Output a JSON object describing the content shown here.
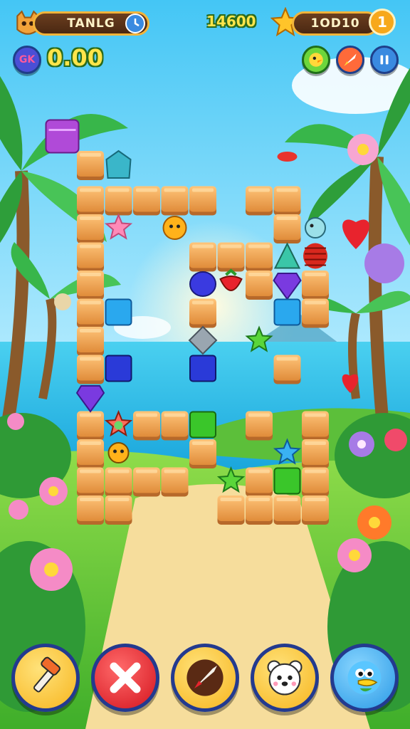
{
  "hud": {
    "left_label": "TANLG",
    "center_score": "14600",
    "right_label": "1OD10",
    "coins_value": "0.00",
    "coin_badge": "GK",
    "right_badge": "1"
  },
  "colors": {
    "tile": "#f0a44e",
    "tile_edge": "#b7692a",
    "sky": "#7fd6ff",
    "sea": "#2ab7e6",
    "grass": "#6bcf3f",
    "sand": "#f6dd9c"
  },
  "board": {
    "tiles": [
      [
        1,
        0
      ],
      [
        1,
        1
      ],
      [
        2,
        1
      ],
      [
        3,
        1
      ],
      [
        4,
        1
      ],
      [
        5,
        1
      ],
      [
        7,
        1
      ],
      [
        8,
        1
      ],
      [
        1,
        2
      ],
      [
        8,
        2
      ],
      [
        1,
        3
      ],
      [
        5,
        3
      ],
      [
        6,
        3
      ],
      [
        7,
        3
      ],
      [
        1,
        4
      ],
      [
        7,
        4
      ],
      [
        9,
        4
      ],
      [
        1,
        5
      ],
      [
        5,
        5
      ],
      [
        9,
        5
      ],
      [
        1,
        6
      ],
      [
        1,
        7
      ],
      [
        8,
        7
      ],
      [
        1,
        9
      ],
      [
        3,
        9
      ],
      [
        4,
        9
      ],
      [
        7,
        9
      ],
      [
        9,
        9
      ],
      [
        1,
        10
      ],
      [
        5,
        10
      ],
      [
        9,
        10
      ],
      [
        1,
        11
      ],
      [
        2,
        11
      ],
      [
        3,
        11
      ],
      [
        4,
        11
      ],
      [
        7,
        11
      ],
      [
        9,
        11
      ],
      [
        1,
        12
      ],
      [
        2,
        12
      ],
      [
        6,
        12
      ],
      [
        7,
        12
      ],
      [
        8,
        12
      ],
      [
        9,
        12
      ]
    ],
    "items": [
      {
        "name": "purple-gem",
        "col": 0,
        "row": -1
      },
      {
        "name": "teal-gem",
        "col": 2,
        "row": 0
      },
      {
        "name": "crab-icon",
        "col": 8,
        "row": 0
      },
      {
        "name": "pink-star",
        "col": 2,
        "row": 2
      },
      {
        "name": "sun-creature",
        "col": 4,
        "row": 2
      },
      {
        "name": "fish-creature",
        "col": 9,
        "row": 2
      },
      {
        "name": "cone-gem",
        "col": 8,
        "row": 3
      },
      {
        "name": "red-barrel",
        "col": 9,
        "row": 3
      },
      {
        "name": "blue-blob",
        "col": 5,
        "row": 4
      },
      {
        "name": "strawberry-icon",
        "col": 6,
        "row": 4
      },
      {
        "name": "purple-diamond",
        "col": 8,
        "row": 4
      },
      {
        "name": "blue-block",
        "col": 2,
        "row": 5
      },
      {
        "name": "blue-block",
        "col": 8,
        "row": 5
      },
      {
        "name": "silver-diamond",
        "col": 5,
        "row": 6
      },
      {
        "name": "green-star",
        "col": 7,
        "row": 6
      },
      {
        "name": "navy-block",
        "col": 2,
        "row": 7
      },
      {
        "name": "navy-block",
        "col": 5,
        "row": 7
      },
      {
        "name": "purple-diamond",
        "col": 1,
        "row": 8
      },
      {
        "name": "green-block",
        "col": 5,
        "row": 9
      },
      {
        "name": "star-creature",
        "col": 2,
        "row": 9
      },
      {
        "name": "bee-creature",
        "col": 2,
        "row": 10
      },
      {
        "name": "blue-star",
        "col": 8,
        "row": 10
      },
      {
        "name": "green-star",
        "col": 6,
        "row": 11
      },
      {
        "name": "green-block",
        "col": 8,
        "row": 11
      }
    ]
  },
  "buttons": [
    {
      "name": "hammer-button",
      "icon": "hammer-icon",
      "color": "#ffc93a"
    },
    {
      "name": "close-button",
      "icon": "close-icon",
      "color": "#e8232d"
    },
    {
      "name": "rocket-button",
      "icon": "rocket-icon",
      "color": "#ffc93a"
    },
    {
      "name": "bear-button",
      "icon": "bear-icon",
      "color": "#ffc93a"
    },
    {
      "name": "bird-button",
      "icon": "bird-icon",
      "color": "#3fb2f2"
    }
  ]
}
